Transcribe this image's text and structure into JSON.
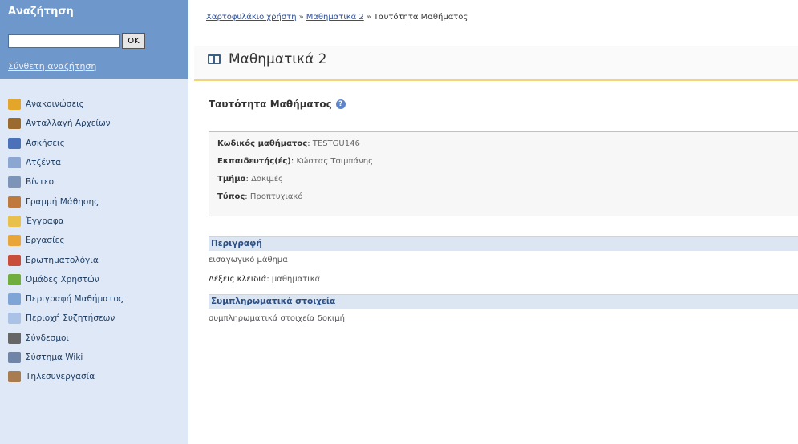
{
  "sidebar": {
    "search_title": "Αναζήτηση",
    "search_value": "",
    "ok_label": "OK",
    "advanced_label": "Σύνθετη αναζήτηση",
    "tools": [
      {
        "label": "Ανακοινώσεις",
        "icon": "megaphone-icon",
        "color": "#e3a52a"
      },
      {
        "label": "Ανταλλαγή Αρχείων",
        "icon": "file-exchange-icon",
        "color": "#9a6a2f"
      },
      {
        "label": "Ασκήσεις",
        "icon": "exercises-icon",
        "color": "#4b72b8"
      },
      {
        "label": "Ατζέντα",
        "icon": "agenda-icon",
        "color": "#8aa6d1"
      },
      {
        "label": "Βίντεο",
        "icon": "video-icon",
        "color": "#7b94b8"
      },
      {
        "label": "Γραμμή Μάθησης",
        "icon": "learning-path-icon",
        "color": "#c0793c"
      },
      {
        "label": "Έγγραφα",
        "icon": "folder-icon",
        "color": "#e8c04b"
      },
      {
        "label": "Εργασίες",
        "icon": "assignments-icon",
        "color": "#e7a53a"
      },
      {
        "label": "Ερωτηματολόγια",
        "icon": "questionnaire-icon",
        "color": "#c94d3b"
      },
      {
        "label": "Ομάδες Χρηστών",
        "icon": "user-groups-icon",
        "color": "#6fae3d"
      },
      {
        "label": "Περιγραφή Μαθήματος",
        "icon": "description-icon",
        "color": "#7fa4d6"
      },
      {
        "label": "Περιοχή Συζητήσεων",
        "icon": "forum-icon",
        "color": "#a9c2e6"
      },
      {
        "label": "Σύνδεσμοι",
        "icon": "links-icon",
        "color": "#666666"
      },
      {
        "label": "Σύστημα Wiki",
        "icon": "wiki-icon",
        "color": "#6f84a6"
      },
      {
        "label": "Τηλεσυνεργασία",
        "icon": "teleconference-icon",
        "color": "#a87c4e"
      }
    ]
  },
  "breadcrumb": {
    "items": [
      "Χαρτοφυλάκιο χρήστη",
      "Μαθηματικά 2"
    ],
    "current": "Ταυτότητα Μαθήματος",
    "separator": "»"
  },
  "course": {
    "title": "Μαθηματικά 2"
  },
  "section": {
    "title": "Ταυτότητα Μαθήματος",
    "help_symbol": "?"
  },
  "info": {
    "code_label": "Κωδικός μαθήματος",
    "code_value": "TESTGU146",
    "instructor_label": "Εκπαιδευτής(ές)",
    "instructor_value": "Κώστας Τσιμπάνης",
    "department_label": "Τμήμα",
    "department_value": "Δοκιμές",
    "type_label": "Τύπος",
    "type_value": "Προπτυχιακό"
  },
  "description": {
    "heading": "Περιγραφή",
    "text": "εισαγωγικό μάθημα",
    "keywords_label": "Λέξεις κλειδιά",
    "keywords_value": "μαθηματικά"
  },
  "extra": {
    "heading": "Συμπληρωματικά στοιχεία",
    "text": "συμπληρωματικά στοιχεία δοκιμή"
  },
  "colors": {
    "sidebar_bg": "#dfe8f6",
    "search_bg": "#6e97cb",
    "header_rule": "#f2d27a",
    "band_bg": "#dce6f2",
    "link": "#2a4fa0"
  }
}
